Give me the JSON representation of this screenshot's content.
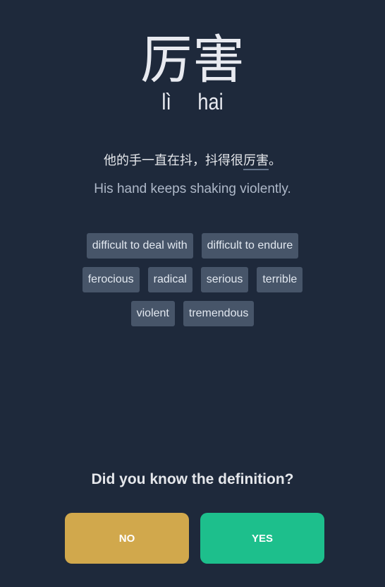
{
  "word": {
    "hanzi": "厉害",
    "pinyin": [
      "lì",
      "hai"
    ]
  },
  "example": {
    "zh_before": "他的手一直在抖，抖得很",
    "zh_highlight": "厉害",
    "zh_after": "。",
    "en": "His hand keeps shaking violently."
  },
  "definitions": [
    [
      "difficult to deal with",
      "difficult to endure"
    ],
    [
      "ferocious",
      "radical",
      "serious",
      "terrible"
    ],
    [
      "violent",
      "tremendous"
    ]
  ],
  "prompt": {
    "question": "Did you know the definition?",
    "no_label": "NO",
    "yes_label": "YES"
  },
  "colors": {
    "background": "#1e293b",
    "chip": "#475569",
    "no_button": "#d1a84c",
    "yes_button": "#1dbf8c"
  }
}
